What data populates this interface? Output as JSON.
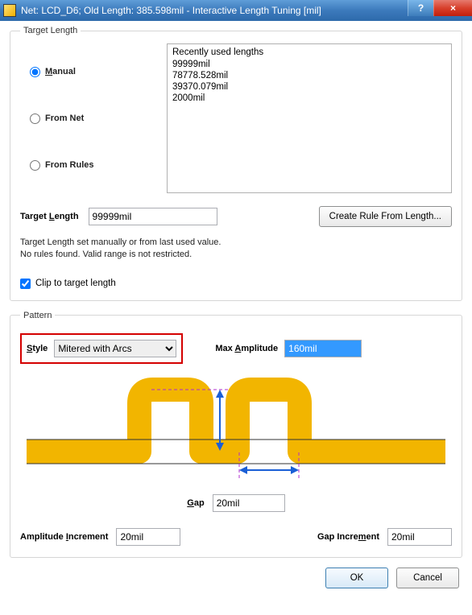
{
  "window": {
    "title": "Net: LCD_D6;  Old Length: 385.598mil  -  Interactive Length Tuning [mil]",
    "help_glyph": "?",
    "close_glyph": "×"
  },
  "target_length": {
    "legend": "Target Length",
    "radios": {
      "manual": "Manual",
      "from_net": "From Net",
      "from_rules": "From Rules"
    },
    "list_header": "Recently used lengths",
    "list_items": [
      "99999mil",
      "78778.528mil",
      "39370.079mil",
      "2000mil"
    ],
    "target_label": "Target Length",
    "target_value": "99999mil",
    "create_rule_btn": "Create Rule From Length...",
    "note_line1": "Target Length set manually or from last used value.",
    "note_line2": " No rules found. Valid range is not restricted.",
    "clip_label": "Clip to target length"
  },
  "pattern": {
    "legend": "Pattern",
    "style_label": "Style",
    "style_value": "Mitered with Arcs",
    "maxamp_label": "Max Amplitude",
    "maxamp_value": "160mil",
    "gap_label": "Gap",
    "gap_value": "20mil",
    "amp_inc_label": "Amplitude Increment",
    "amp_inc_value": "20mil",
    "gap_inc_label": "Gap Increment",
    "gap_inc_value": "20mil"
  },
  "footer": {
    "ok": "OK",
    "cancel": "Cancel"
  }
}
